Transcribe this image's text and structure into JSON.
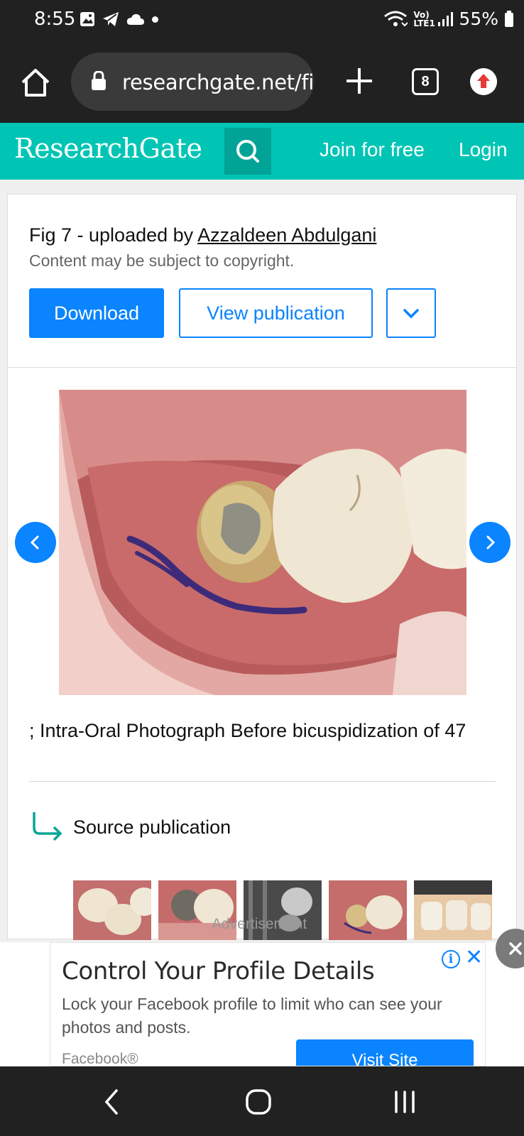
{
  "status_bar": {
    "time": "8:55",
    "network": "Vo) LTE1",
    "battery": "55%",
    "icons": [
      "image-icon",
      "telegram-icon",
      "cloud-icon",
      "dot-icon",
      "wifi-icon",
      "signal-icon",
      "battery-icon"
    ]
  },
  "browser": {
    "url": "researchgate.net/fig",
    "tab_count": "8"
  },
  "header": {
    "logo": "ResearchGate",
    "join": "Join for free",
    "login": "Login",
    "accent_color": "#00c5b5"
  },
  "figure": {
    "title_prefix": "Fig 7 - uploaded by ",
    "author": "Azzaldeen Abdulgani",
    "copyright": "Content may be subject to copyright.",
    "download_label": "Download",
    "view_label": "View publication",
    "caption": "; Intra-Oral Photograph Before bicuspidization of 47"
  },
  "source": {
    "label": "Source publication"
  },
  "ad": {
    "label": "Advertisement",
    "title": "Control Your Profile Details",
    "body": "Lock your Facebook profile to limit who can see your photos and posts.",
    "brand": "Facebook®",
    "cta": "Visit Site",
    "info_glyph": "i",
    "close_glyph": "✕"
  }
}
